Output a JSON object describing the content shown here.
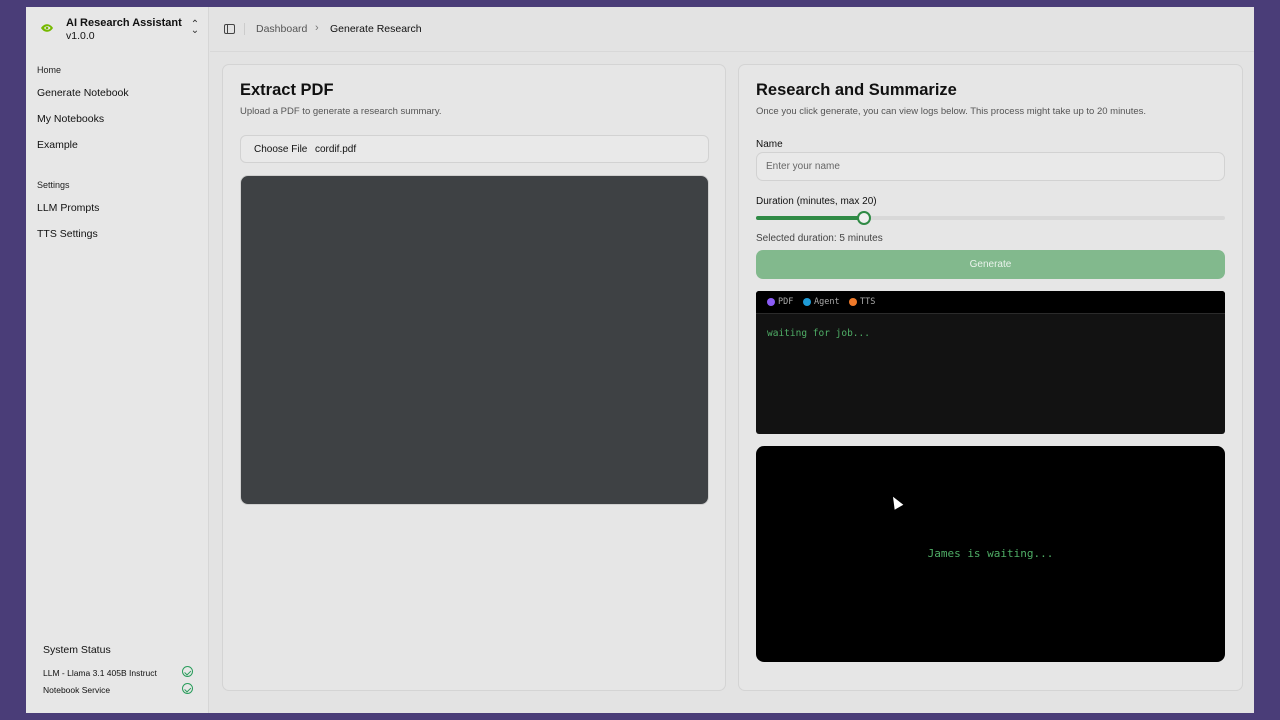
{
  "app": {
    "title": "AI Research Assistant",
    "version": "v1.0.0"
  },
  "sidebar": {
    "home_label": "Home",
    "home_items": [
      {
        "label": "Generate Notebook"
      },
      {
        "label": "My Notebooks"
      },
      {
        "label": "Example"
      }
    ],
    "settings_label": "Settings",
    "settings_items": [
      {
        "label": "LLM Prompts"
      },
      {
        "label": "TTS Settings"
      }
    ],
    "system_status": {
      "title": "System Status",
      "services": [
        {
          "name": "LLM - Llama 3.1 405B Instruct",
          "status": "ok"
        },
        {
          "name": "Notebook Service",
          "status": "ok"
        }
      ]
    }
  },
  "header": {
    "breadcrumb": [
      "Dashboard",
      "Generate Research"
    ],
    "separator": "›"
  },
  "extract_card": {
    "title": "Extract PDF",
    "subtitle": "Upload a PDF to generate a research summary.",
    "file_button": "Choose File",
    "file_name": "cordif.pdf"
  },
  "research_card": {
    "title": "Research and Summarize",
    "subtitle": "Once you click generate, you can view logs below. This process might take up to 20 minutes.",
    "name_label": "Name",
    "name_placeholder": "Enter your name",
    "name_value": "",
    "duration_label": "Duration (minutes, max 20)",
    "duration_value": 5,
    "duration_max": 20,
    "duration_note": "Selected duration: 5 minutes",
    "generate_label": "Generate",
    "log_legend": [
      {
        "label": "PDF",
        "color": "#8b5cf6"
      },
      {
        "label": "Agent",
        "color": "#1e9bd7"
      },
      {
        "label": "TTS",
        "color": "#f07a2a"
      }
    ],
    "log_text": "waiting for job...",
    "player_text": "James is waiting..."
  },
  "colors": {
    "accent": "#2f8a45",
    "button_disabled": "#82b98d",
    "log_text": "#4fae66",
    "status_ok": "#2a9d5c"
  }
}
